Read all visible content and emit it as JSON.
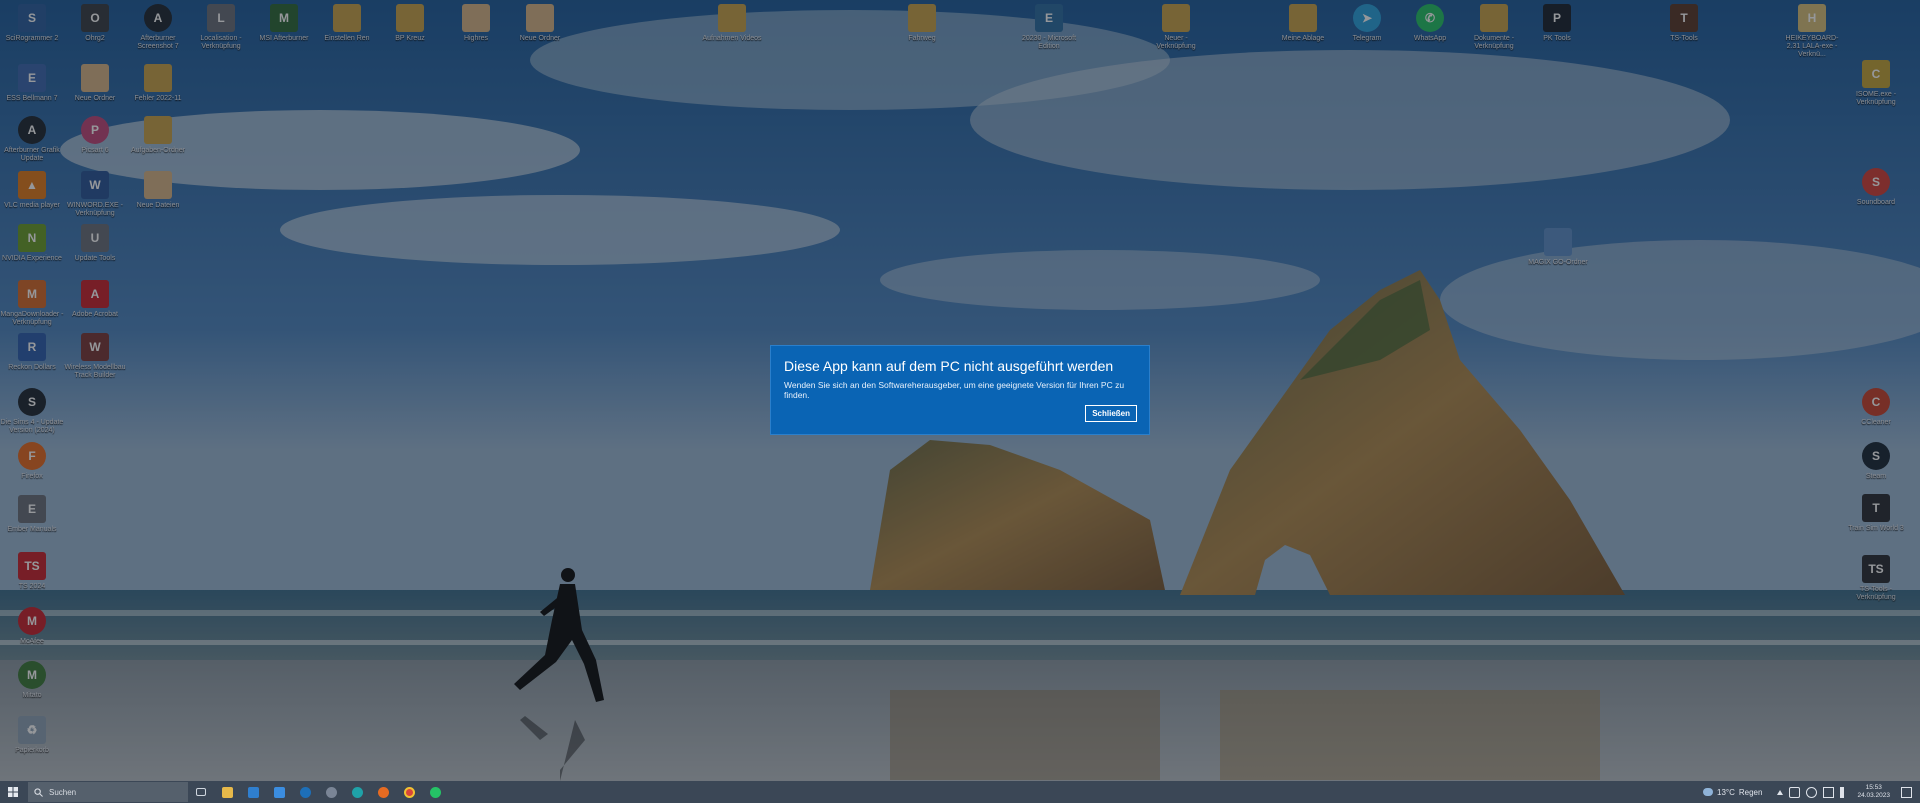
{
  "desktop": {
    "icons": [
      {
        "label": "SciRogrammer 2"
      },
      {
        "label": "Ohrg2"
      },
      {
        "label": "Afterburner Screenshot 7"
      },
      {
        "label": "Localisation - Verknüpfung"
      },
      {
        "label": "MSI Afterburner"
      },
      {
        "label": "Einstellen Ren"
      },
      {
        "label": "BP Kreuz"
      },
      {
        "label": "Highres"
      },
      {
        "label": "Neue Ordner"
      },
      {
        "label": "Aufnahmen Videos"
      },
      {
        "label": "Fahrweg"
      },
      {
        "label": "20230 - Microsoft Edition"
      },
      {
        "label": "Neuer - Verknüpfung"
      },
      {
        "label": "Meine Ablage"
      },
      {
        "label": "Telegram"
      },
      {
        "label": "WhatsApp"
      },
      {
        "label": "Dokumente - Verknüpfung"
      },
      {
        "label": "PK Tools"
      },
      {
        "label": "TS-Tools"
      },
      {
        "label": "HEIKEYBOARD-2.31 LALA-exe - Verknü..."
      },
      {
        "label": "ESS Bellmann 7"
      },
      {
        "label": "Neue Ordner"
      },
      {
        "label": "Fehler 2022-11"
      },
      {
        "label": "ISOME.exe - Verknüpfung"
      },
      {
        "label": "Afterburner Grafik Update"
      },
      {
        "label": "Picsart 6"
      },
      {
        "label": "Aufgaben-Ordner"
      },
      {
        "label": "VLC media player"
      },
      {
        "label": "WINWORD.EXE - Verknüpfung"
      },
      {
        "label": "Neue Dateien"
      },
      {
        "label": "Soundboard"
      },
      {
        "label": "NVIDIA Experience"
      },
      {
        "label": "Update Tools"
      },
      {
        "label": "MAGIX GO-Ordner"
      },
      {
        "label": "MangaDownloader - Verknüpfung"
      },
      {
        "label": "Adobe Acrobat"
      },
      {
        "label": "Reckon Dollars"
      },
      {
        "label": "Wireless Modellbau Track Builder"
      },
      {
        "label": "CCleaner"
      },
      {
        "label": "Die Sims 4 - Update Version (2024)"
      },
      {
        "label": "Steam"
      },
      {
        "label": "Firefox"
      },
      {
        "label": "Train Sim World 3"
      },
      {
        "label": "Ember Manuals"
      },
      {
        "label": "TS-Tools - Verknüpfung"
      },
      {
        "label": "TS 2024"
      },
      {
        "label": "McAfee"
      },
      {
        "label": "Mitato"
      },
      {
        "label": "Papierkorb"
      }
    ]
  },
  "dialog": {
    "title": "Diese App kann auf dem PC nicht ausgeführt werden",
    "message": "Wenden Sie sich an den Softwareherausgeber, um eine geeignete Version für Ihren PC zu finden.",
    "close_label": "Schließen"
  },
  "taskbar": {
    "search_placeholder": "Suchen",
    "weather_temp": "13°C",
    "weather_text": "Regen",
    "time": "15:53",
    "date": "24.03.2023"
  },
  "colors": {
    "dialog_bg": "#0a64b4",
    "taskbar_bg": "#3b4756"
  }
}
